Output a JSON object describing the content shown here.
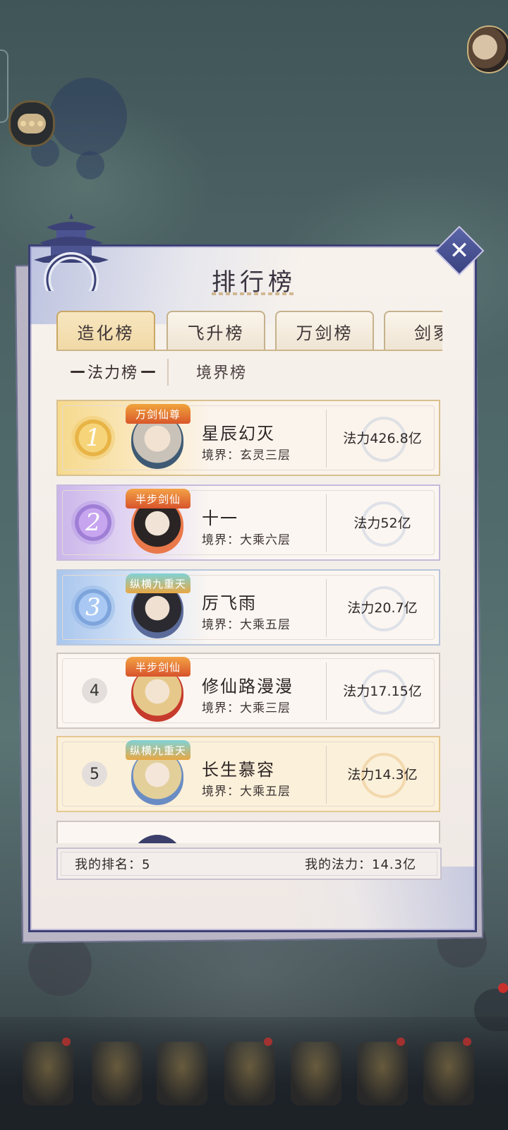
{
  "panel": {
    "title": "排行榜",
    "tabs": [
      {
        "label": "造化榜",
        "active": true
      },
      {
        "label": "飞升榜",
        "active": false
      },
      {
        "label": "万剑榜",
        "active": false
      },
      {
        "label": "剑冢",
        "active": false
      }
    ],
    "subtabs": [
      {
        "label": "法力榜",
        "active": true
      },
      {
        "label": "境界榜",
        "active": false
      }
    ],
    "rows": [
      {
        "rank": "1",
        "badge": "万剑仙尊",
        "name": "星辰幻灭",
        "realm": "境界：玄灵三层",
        "power": "法力426.8亿"
      },
      {
        "rank": "2",
        "badge": "半步剑仙",
        "name": "十一",
        "realm": "境界：大乘六层",
        "power": "法力52亿"
      },
      {
        "rank": "3",
        "badge": "纵横九重天",
        "name": "厉飞雨",
        "realm": "境界：大乘五层",
        "power": "法力20.7亿"
      },
      {
        "rank": "4",
        "badge": "半步剑仙",
        "name": "修仙路漫漫",
        "realm": "境界：大乘三层",
        "power": "法力17.15亿"
      },
      {
        "rank": "5",
        "badge": "纵横九重天",
        "name": "长生慕容",
        "realm": "境界：大乘五层",
        "power": "法力14.3亿"
      }
    ],
    "footer": {
      "my_rank": "我的排名：5",
      "my_power": "我的法力：14.3亿"
    }
  }
}
